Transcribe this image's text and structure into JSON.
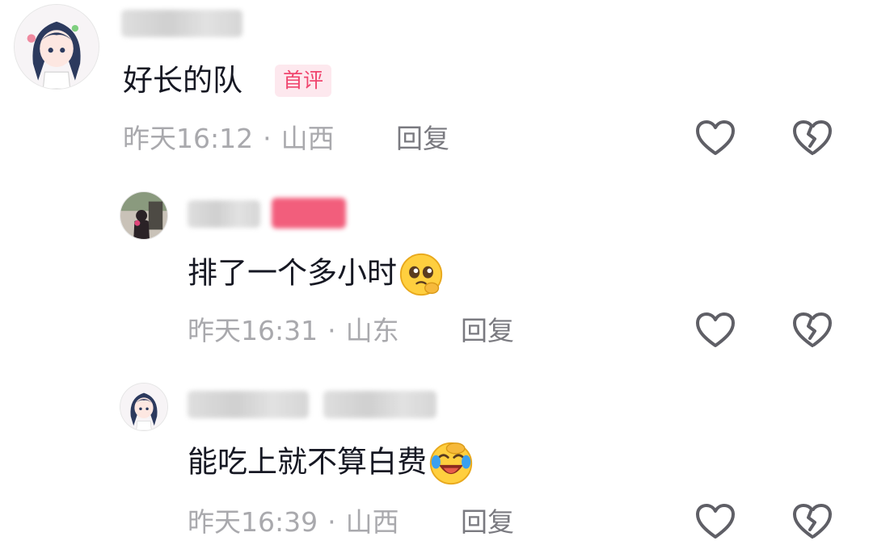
{
  "comments": [
    {
      "text": "好长的队",
      "badge": "首评",
      "time": "昨天16:12",
      "location": "山西",
      "reply_label": "回复",
      "avatar": "anime-girl-avatar-icon"
    },
    {
      "text": "排了一个多小时",
      "emoji": "pleading-face-icon",
      "time": "昨天16:31",
      "location": "山东",
      "reply_label": "回复",
      "avatar": "photo-avatar-icon"
    },
    {
      "text": "能吃上就不算白费",
      "emoji": "rolling-laugh-icon",
      "time": "昨天16:39",
      "location": "山西",
      "reply_label": "回复",
      "avatar": "anime-girl-avatar-icon"
    }
  ],
  "separator": "·",
  "icons": {
    "like": "heart-outline-icon",
    "dislike": "broken-heart-icon"
  },
  "colors": {
    "badge_text": "#f0456e",
    "badge_bg": "#fde8ee",
    "meta_text": "#a9a9ad",
    "icon_stroke": "#5f5f66"
  }
}
